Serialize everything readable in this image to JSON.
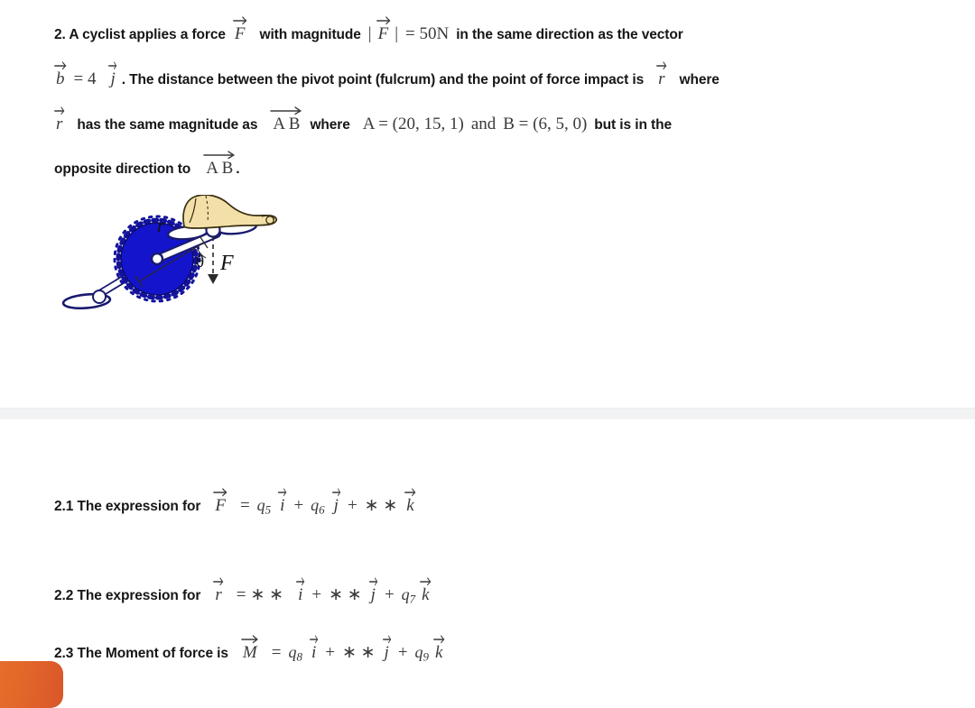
{
  "document": {
    "background_color": "#ffffff",
    "accent_color": "#e8732c",
    "gear_color": "#1414cd",
    "separator_color": "#f1f2f3"
  },
  "question": {
    "number": "2.",
    "line1": {
      "t1": "2. A cyclist applies a force",
      "v1": "F",
      "t2": "with magnitude",
      "bar_open": "|",
      "v2": "F",
      "bar_close": "|",
      "t3": "= 50N",
      "t4": "in the same direction as the vector"
    },
    "line2": {
      "v1": "b",
      "t1": "= 4",
      "v2": "j",
      "t2": ". The distance between the pivot point (fulcrum) and the point of force impact is",
      "v3": "r",
      "t3": "where"
    },
    "line3": {
      "v1": "r",
      "t1": "has the same magnitude as",
      "v2": "A B",
      "t2": "where",
      "t3": "A = (20, 15, 1)",
      "t4": "and",
      "t5": "B = (6, 5, 0)",
      "t6": "but is in the"
    },
    "line4": {
      "t1": "opposite direction to",
      "v1": "A B",
      "t2": "."
    }
  },
  "figure": {
    "name": "bicycle-pedal-crank-diagram",
    "label_r": "r",
    "label_theta": "θ",
    "label_F": "F",
    "description": "Foot on a bicycle pedal attached by a crank arm to a blue toothed chainring, with radius r, angle theta and downward force F"
  },
  "answers": [
    {
      "id": "2.1",
      "prompt": "2.1 The expression for",
      "lhs": "F",
      "eq": "=",
      "terms": [
        {
          "coef": "q",
          "sub": "5",
          "unit": "i",
          "op": "+"
        },
        {
          "coef": "q",
          "sub": "6",
          "unit": "j",
          "op": "+"
        },
        {
          "coef": "∗ ∗",
          "sub": "",
          "unit": "k",
          "op": ""
        }
      ]
    },
    {
      "id": "2.2",
      "prompt": "2.2 The expression for",
      "lhs": "r",
      "eq": "=",
      "terms": [
        {
          "coef": "∗ ∗",
          "sub": "",
          "unit": "i",
          "op": "+"
        },
        {
          "coef": "∗ ∗",
          "sub": "",
          "unit": "j",
          "op": "+"
        },
        {
          "coef": "q",
          "sub": "7",
          "unit": "k",
          "op": ""
        }
      ]
    },
    {
      "id": "2.3",
      "prompt": "2.3 The Moment of force is",
      "lhs": "M",
      "eq": "=",
      "terms": [
        {
          "coef": "q",
          "sub": "8",
          "unit": "i",
          "op": "+"
        },
        {
          "coef": "∗ ∗",
          "sub": "",
          "unit": "j",
          "op": "+"
        },
        {
          "coef": "q",
          "sub": "9",
          "unit": "k",
          "op": ""
        }
      ]
    }
  ]
}
